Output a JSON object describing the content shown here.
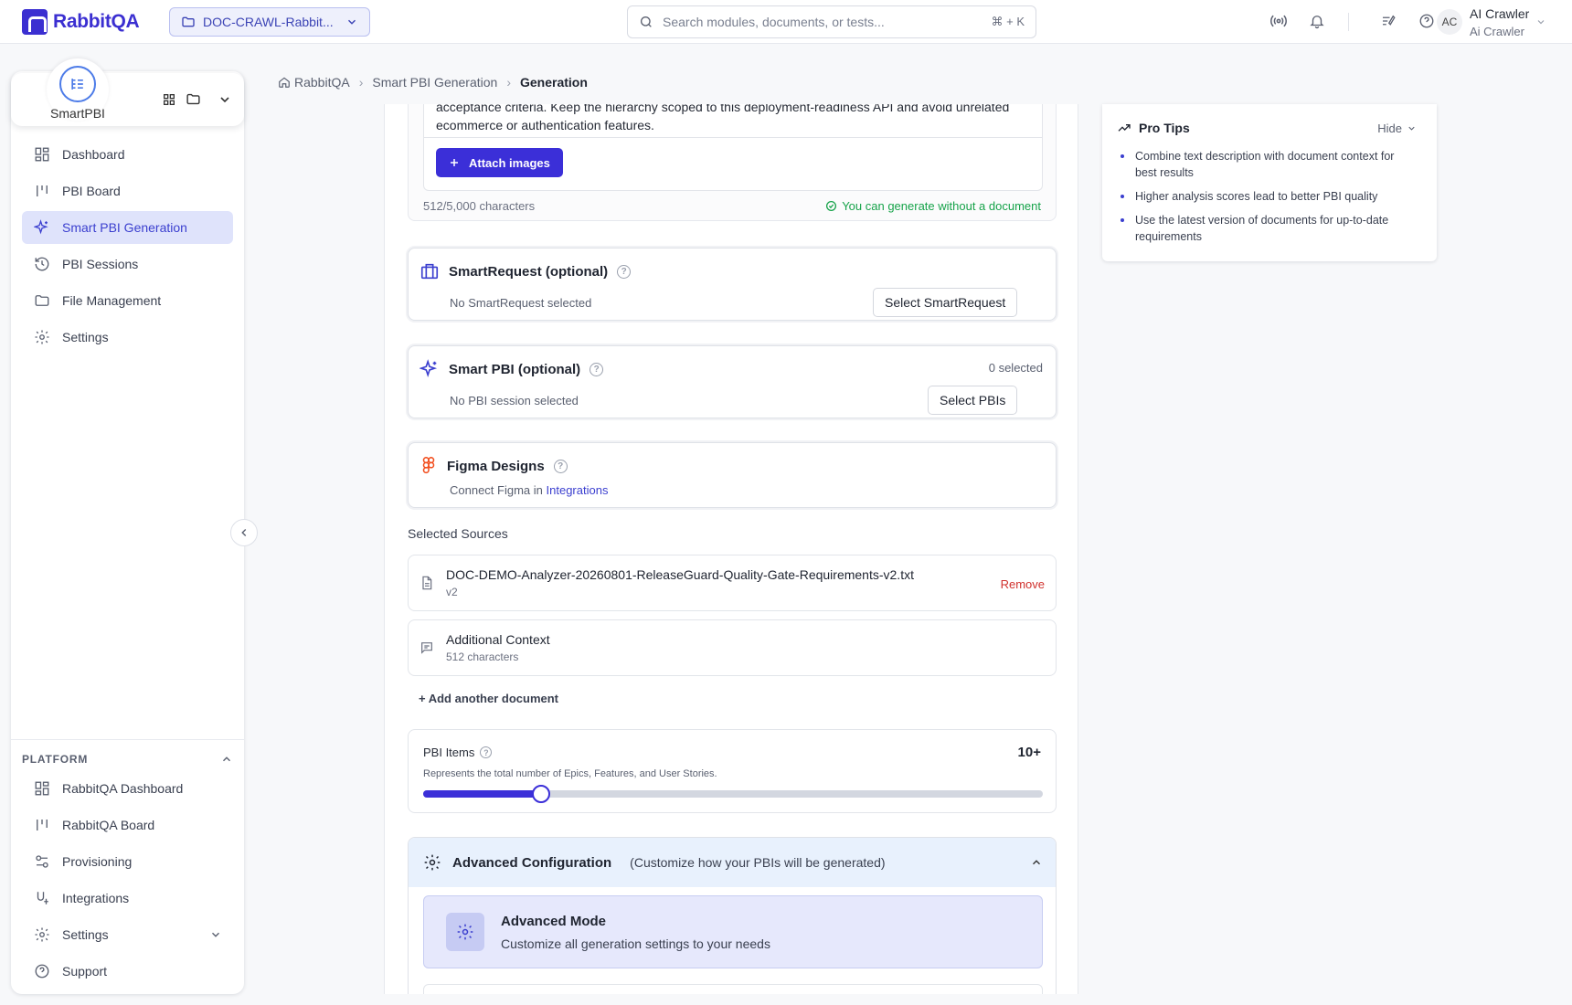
{
  "topbar": {
    "logo_text": "RabbitQA",
    "project": "DOC-CRAWL-Rabbit...",
    "search_placeholder": "Search modules, documents, or tests...",
    "search_shortcut": "⌘ + K",
    "avatar_initials": "AC",
    "user_name": "AI Crawler",
    "user_role": "Ai Crawler"
  },
  "sidebar": {
    "app_name": "SmartPBI",
    "items": [
      {
        "label": "Dashboard",
        "icon": "dashboard-icon"
      },
      {
        "label": "PBI Board",
        "icon": "board-icon"
      },
      {
        "label": "Smart PBI Generation",
        "icon": "sparkle-icon",
        "active": true
      },
      {
        "label": "PBI Sessions",
        "icon": "history-icon"
      },
      {
        "label": "File Management",
        "icon": "folder-icon"
      },
      {
        "label": "Settings",
        "icon": "gear-icon"
      }
    ],
    "platform_title": "PLATFORM",
    "platform_items": [
      {
        "label": "RabbitQA Dashboard",
        "icon": "dashboard-icon"
      },
      {
        "label": "RabbitQA Board",
        "icon": "board-icon"
      },
      {
        "label": "Provisioning",
        "icon": "provisioning-icon"
      },
      {
        "label": "Integrations",
        "icon": "integrations-icon"
      },
      {
        "label": "Settings",
        "icon": "gear-icon"
      },
      {
        "label": "Support",
        "icon": "help-icon"
      }
    ]
  },
  "breadcrumb": {
    "home": "RabbitQA",
    "section": "Smart PBI Generation",
    "current": "Generation"
  },
  "description": {
    "text": "acceptance criteria. Keep the hierarchy scoped to this deployment-readiness API and avoid unrelated ecommerce or authentication features.",
    "attach_label": "Attach images",
    "char_count": "512/5,000 characters",
    "status": "You can generate without a document"
  },
  "smart_request": {
    "title": "SmartRequest (optional)",
    "empty": "No SmartRequest selected",
    "button": "Select SmartRequest"
  },
  "smart_pbi": {
    "title": "Smart PBI (optional)",
    "count": "0 selected",
    "empty": "No PBI session selected",
    "button": "Select PBIs"
  },
  "figma": {
    "title": "Figma Designs",
    "prefix": "Connect Figma in",
    "link": "Integrations"
  },
  "selected_sources": {
    "label": "Selected Sources",
    "items": [
      {
        "name": "DOC-DEMO-Analyzer-20260801-ReleaseGuard-Quality-Gate-Requirements-v2.txt",
        "sub": "v2",
        "action": "Remove"
      },
      {
        "name": "Additional Context",
        "sub": "512 characters"
      }
    ],
    "add_label": "+ Add another document"
  },
  "pbi_items": {
    "label": "PBI Items",
    "value_label": "10+",
    "description": "Represents the total number of Epics, Features, and User Stories.",
    "slider_fraction": 0.19
  },
  "advanced": {
    "title": "Advanced Configuration",
    "subtitle": "(Customize how your PBIs will be generated)",
    "mode_title": "Advanced Mode",
    "mode_desc": "Customize all generation settings to your needs"
  },
  "pro_tips": {
    "title": "Pro Tips",
    "hide_label": "Hide",
    "tips": [
      "Combine text description with document context for best results",
      "Higher analysis scores lead to better PBI quality",
      "Use the latest version of documents for up-to-date requirements"
    ]
  },
  "colors": {
    "accent": "#3b2fd8",
    "active_bg": "#dfe3fb",
    "success": "#17a34a",
    "danger": "#d0312d"
  }
}
